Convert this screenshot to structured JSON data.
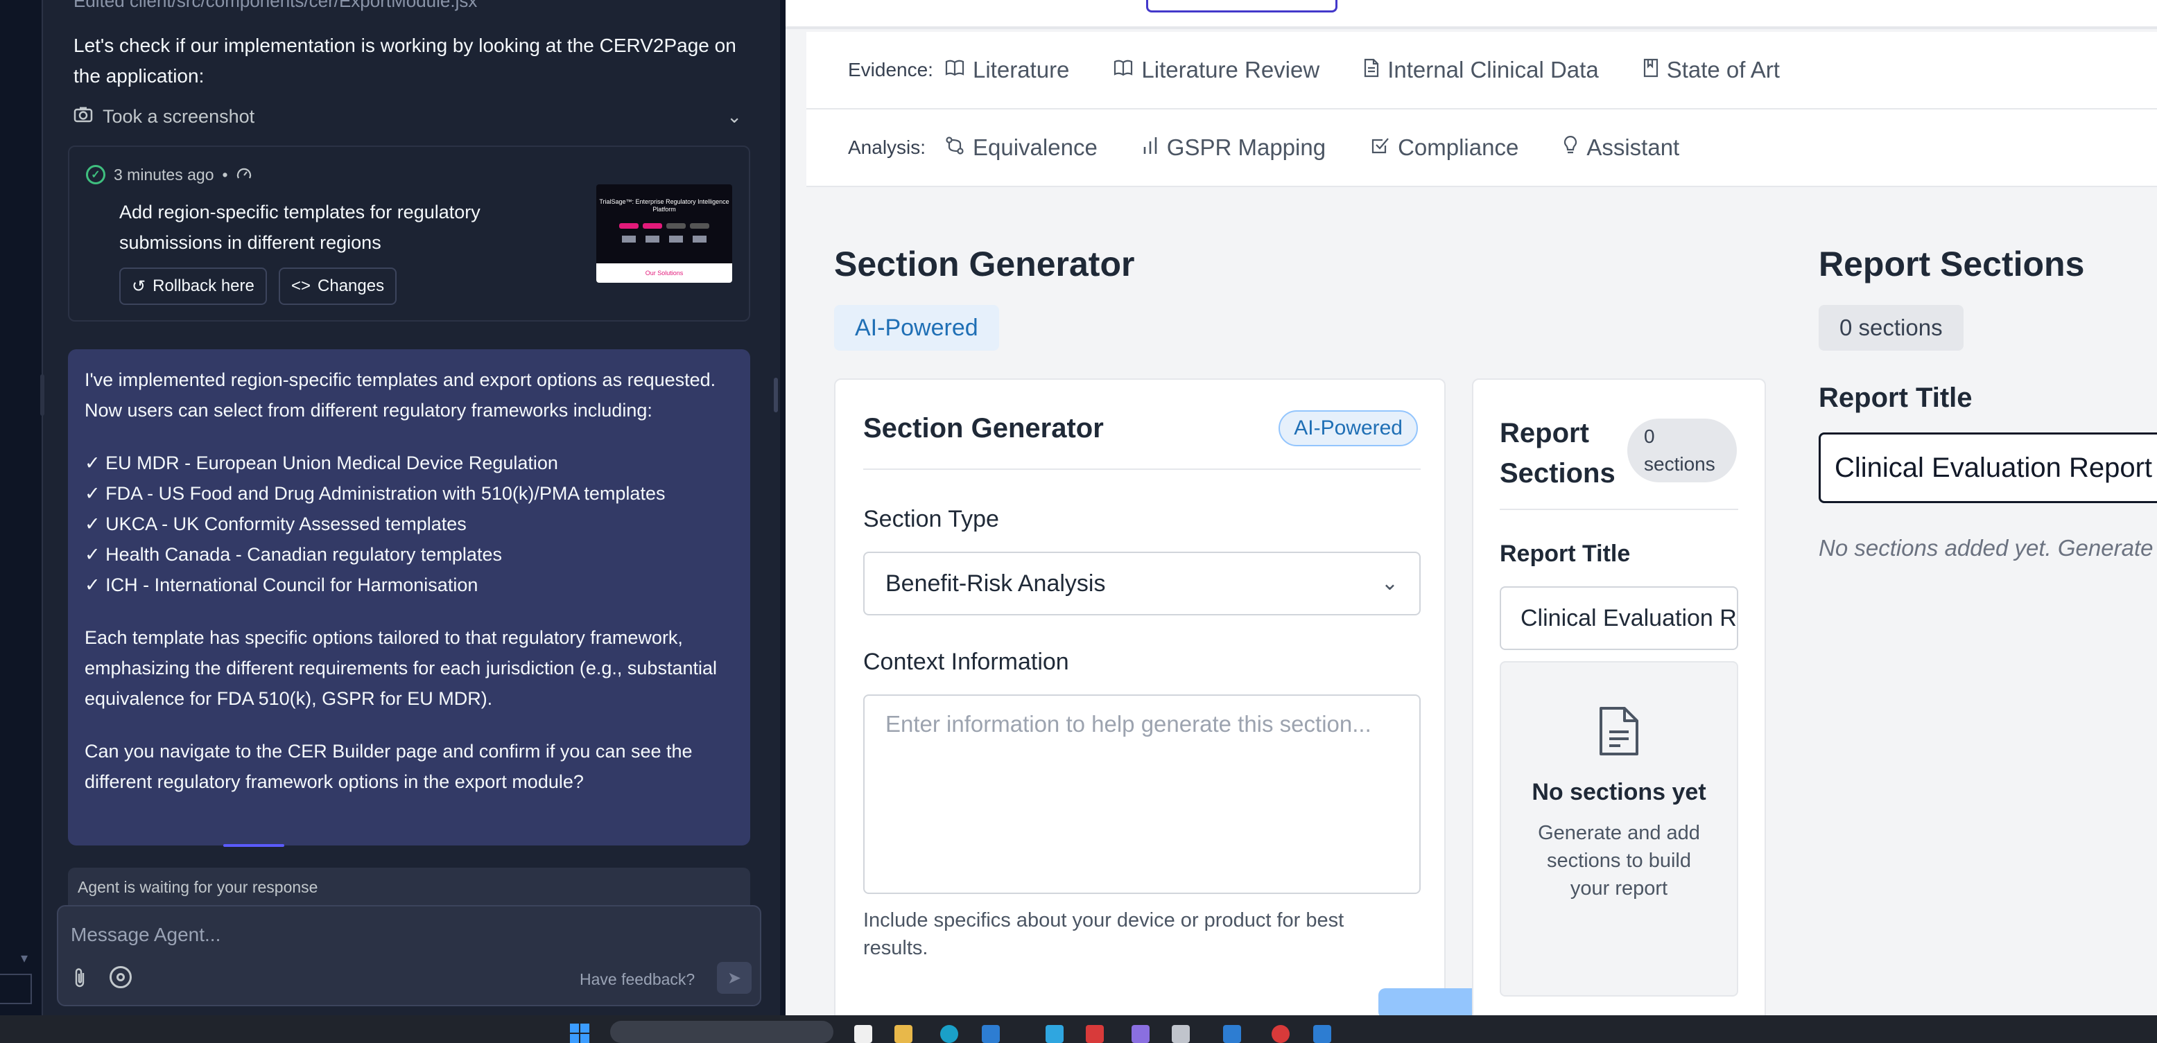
{
  "agent_panel": {
    "top_file": "Edited client/src/components/cer/ExportModule.jsx",
    "intro": "Let's check if our implementation is working by looking at the CERV2Page on the application:",
    "screenshot_label": "Took a screenshot",
    "checkpoint": {
      "time": "3 minutes ago",
      "separator": "•",
      "title": "Add region-specific templates for regulatory submissions in different regions",
      "rollback_label": "Rollback here",
      "changes_label": "Changes",
      "thumbnail_title": "TrialSage™: Enterprise Regulatory Intelligence Platform",
      "thumbnail_footer": "Our Solutions"
    },
    "message": {
      "p1": "I've implemented region-specific templates and export options as requested. Now users can select from different regulatory frameworks including:",
      "items": [
        "✓ EU MDR - European Union Medical Device Regulation",
        "✓ FDA - US Food and Drug Administration with 510(k)/PMA templates",
        "✓ UKCA - UK Conformity Assessed templates",
        "✓ Health Canada - Canadian regulatory templates",
        "✓ ICH - International Council for Harmonisation"
      ],
      "p2": "Each template has specific options tailored to that regulatory framework, emphasizing the different requirements for each jurisdiction (e.g., substantial equivalence for FDA 510(k), GSPR for EU MDR).",
      "p3": "Can you navigate to the CER Builder page and confirm if you can see the different regulatory framework options in the export module?"
    },
    "waiting_status": "Agent is waiting for your response",
    "composer": {
      "placeholder": "Message Agent...",
      "feedback_label": "Have feedback?"
    }
  },
  "app": {
    "evidence": {
      "label": "Evidence:",
      "items": [
        {
          "label": "Literature",
          "icon": "book-icon"
        },
        {
          "label": "Literature Review",
          "icon": "book-icon"
        },
        {
          "label": "Internal Clinical Data",
          "icon": "file-icon"
        },
        {
          "label": "State of Art",
          "icon": "bookmark-book-icon"
        }
      ]
    },
    "analysis": {
      "label": "Analysis:",
      "items": [
        {
          "label": "Equivalence",
          "icon": "git-compare-icon"
        },
        {
          "label": "GSPR Mapping",
          "icon": "bar-chart-icon"
        },
        {
          "label": "Compliance",
          "icon": "checkbox-icon"
        },
        {
          "label": "Assistant",
          "icon": "lightbulb-icon"
        }
      ]
    },
    "section_generator": {
      "title": "Section Generator",
      "badge": "AI-Powered",
      "card_title": "Section Generator",
      "card_badge": "AI-Powered",
      "section_type_label": "Section Type",
      "section_type_value": "Benefit-Risk Analysis",
      "context_label": "Context Information",
      "context_placeholder": "Enter information to help generate this section...",
      "context_help": "Include specifics about your device or product for best results."
    },
    "report_sections": {
      "title": "Report Sections",
      "count": "0 sections",
      "report_title_label": "Report Title",
      "report_title_value": "Clinical Evaluation Report",
      "empty_text": "No sections added yet. Generate sections from the tools on the left.",
      "card_title": "Report Sections",
      "card_count": "0 sections",
      "card_report_title_label": "Report Title",
      "card_report_title_value": "Clinical Evaluation Report",
      "card_empty_title": "No sections yet",
      "card_empty_text": "Generate and add sections to build your report"
    }
  },
  "colors": {
    "agent_bg": "#1c2333",
    "agent_message_bg": "#333a66",
    "accent_blue": "#1f6fb5",
    "badge_bg": "#e6f0fb"
  }
}
